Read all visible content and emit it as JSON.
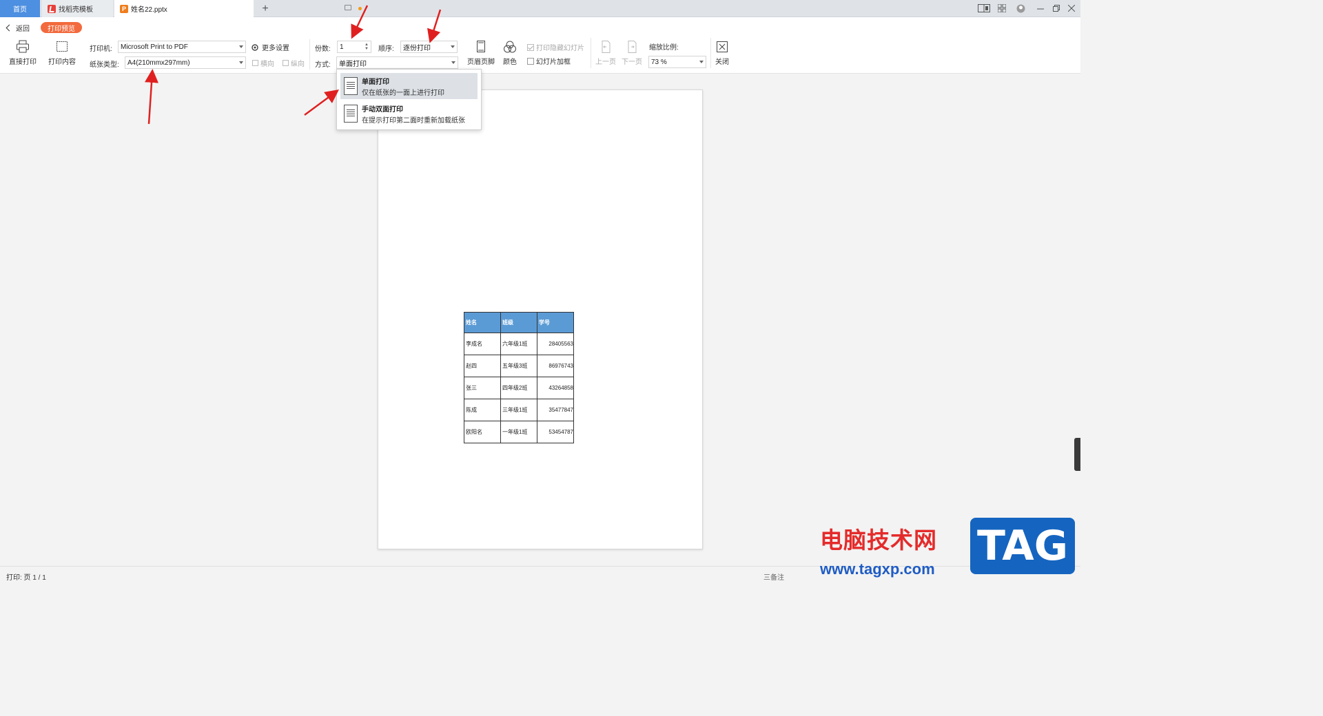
{
  "tabs": {
    "home": "首页",
    "template": "找稻壳模板",
    "file": "姓名22.pptx",
    "add": "+"
  },
  "header": {
    "back": "返回",
    "preview_badge": "打印预览"
  },
  "toolbar": {
    "direct_print": "直接打印",
    "print_content": "打印内容",
    "printer_label": "打印机:",
    "printer_value": "Microsoft Print to PDF",
    "paper_label": "纸张类型:",
    "paper_value": "A4(210mmx297mm)",
    "more_settings": "更多设置",
    "landscape": "横向",
    "portrait": "纵向",
    "copies_label": "份数:",
    "copies_value": "1",
    "order_label": "顺序:",
    "order_value": "逐份打印",
    "mode_label": "方式:",
    "mode_value": "单面打印",
    "header_footer": "页眉页脚",
    "color": "颜色",
    "print_hidden_slides": "打印隐藏幻灯片",
    "slide_frame": "幻灯片加框",
    "prev_page": "上一页",
    "next_page": "下一页",
    "zoom_label": "缩放比例:",
    "zoom_value": "73 %",
    "close": "关闭"
  },
  "dropdown": {
    "items": [
      {
        "title": "单面打印",
        "desc": "仅在纸张的一面上进行打印"
      },
      {
        "title": "手动双面打印",
        "desc": "在提示打印第二面时重新加载纸张"
      }
    ]
  },
  "preview_table": {
    "headers": [
      "姓名",
      "班级",
      "学号"
    ],
    "rows": [
      [
        "李成名",
        "六年级1班",
        "28405563"
      ],
      [
        "赵四",
        "五年级3班",
        "86976743"
      ],
      [
        "张三",
        "四年级2班",
        "43264858"
      ],
      [
        "陈成",
        "三年级1班",
        "35477847"
      ],
      [
        "欧阳名",
        "一年级1班",
        "53454787"
      ]
    ]
  },
  "status": {
    "print_info": "打印: 页 1 / 1",
    "note": "三备注"
  },
  "watermark": {
    "site_name": "电脑技术网",
    "url": "www.tagxp.com",
    "badge": "TAG"
  },
  "colors": {
    "accent_blue": "#4d8fe0",
    "badge_orange": "#f26a3d",
    "table_header": "#5b9bd5",
    "arrow_red": "#e02020"
  }
}
